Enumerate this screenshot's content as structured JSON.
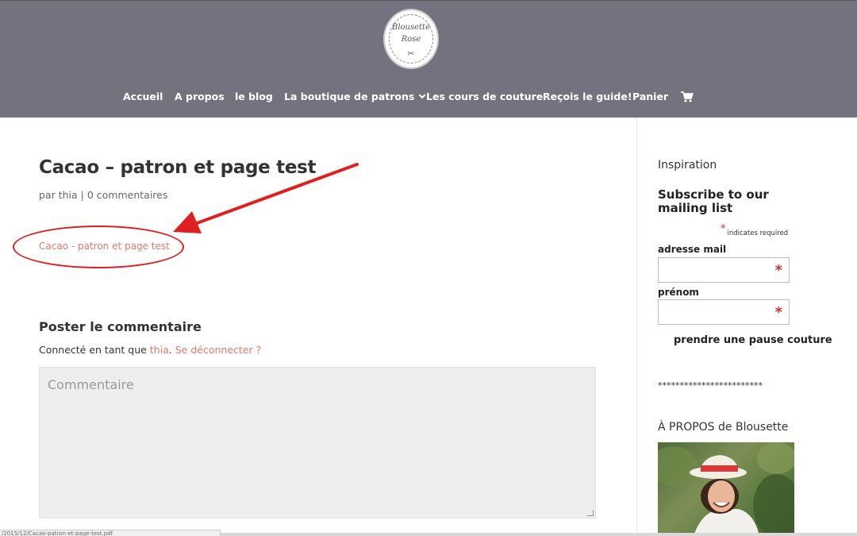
{
  "logo": {
    "line1": "Blousette",
    "line2": "Rose",
    "scissors": "✂"
  },
  "nav": {
    "items": [
      {
        "label": "Accueil"
      },
      {
        "label": "A propos"
      },
      {
        "label": "le blog"
      },
      {
        "label": "La boutique de patrons"
      },
      {
        "label": "Les cours de couture"
      },
      {
        "label": "Reçois le guide!"
      },
      {
        "label": "Panier"
      }
    ],
    "cart_icon": "cart-icon"
  },
  "post": {
    "title": "Cacao – patron et page test",
    "meta_prefix": "par ",
    "author": "thia",
    "separator": " | ",
    "comments": "0 commentaires",
    "link_text": "Cacao - patron et page test"
  },
  "comment_form": {
    "heading": "Poster le commentaire",
    "logged_in_prefix": "Connecté en tant que ",
    "user": "thia",
    "dot": ". ",
    "logout": "Se déconnecter ?",
    "placeholder": "Commentaire"
  },
  "sidebar": {
    "inspiration": "Inspiration",
    "subscribe_title": "Subscribe to our mailing list",
    "required_mark": "*",
    "required_text": "indicates required",
    "email_label": "adresse mail",
    "firstname_label": "prénom",
    "field_mark": "*",
    "button_label": "prendre une pause couture",
    "stars": "************************",
    "about_title": "À PROPOS de Blousette"
  },
  "statusbar": {
    "text": "/2015/12/Cacao-patron-et-page-test.pdf"
  },
  "colors": {
    "header": "#75727f",
    "accent": "#e07a6e",
    "annotation": "#e02020"
  }
}
